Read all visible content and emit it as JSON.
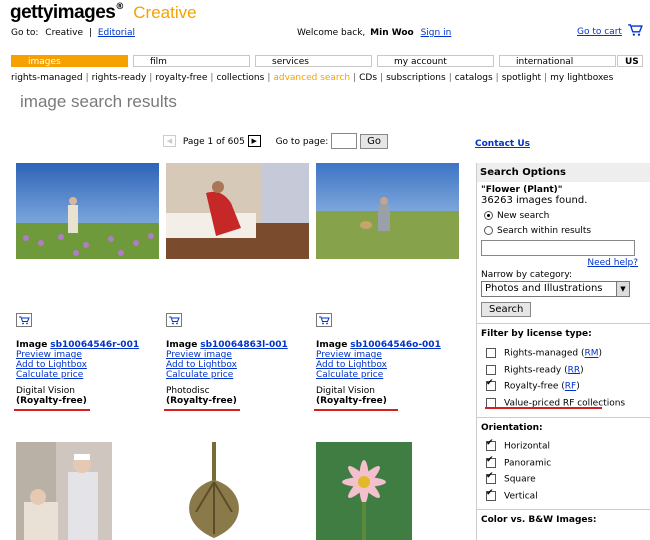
{
  "header": {
    "brand": "gettyimages",
    "brand_reg": "®",
    "brand_sub": "Creative",
    "goto_label": "Go to:",
    "goto_current": "Creative",
    "goto_sep": "|",
    "goto_link": "Editorial",
    "welcome": "Welcome back,",
    "user": "Min Woo",
    "signin": "Sign in",
    "cart": "Go to cart"
  },
  "nav": {
    "tabs": [
      {
        "label": "images",
        "active": true
      },
      {
        "label": "film"
      },
      {
        "label": "services"
      },
      {
        "label": "my account"
      },
      {
        "label": "international"
      }
    ],
    "region": "US",
    "subnav": [
      "rights-managed",
      "rights-ready",
      "royalty-free",
      "collections",
      "advanced search",
      "CDs",
      "subscriptions",
      "catalogs",
      "spotlight",
      "my lightboxes"
    ]
  },
  "page": {
    "title": "image search results",
    "pager": {
      "label": "Page 1 of 605",
      "goto": "Go to page:",
      "go": "Go"
    },
    "contact": "Contact Us"
  },
  "results": [
    {
      "label": "Image",
      "id": "sb10064546r-001",
      "preview": "Preview image",
      "lightbox": "Add to Lightbox",
      "price": "Calculate price",
      "collection": "Digital Vision",
      "license": "(Royalty-free)"
    },
    {
      "label": "Image",
      "id": "sb10064863l-001",
      "preview": "Preview image",
      "lightbox": "Add to Lightbox",
      "price": "Calculate price",
      "collection": "Photodisc",
      "license": "(Royalty-free)"
    },
    {
      "label": "Image",
      "id": "sb10064546o-001",
      "preview": "Preview image",
      "lightbox": "Add to Lightbox",
      "price": "Calculate price",
      "collection": "Digital Vision",
      "license": "(Royalty-free)"
    }
  ],
  "sidebar": {
    "title": "Search Options",
    "query": "\"Flower (Plant)\"",
    "count": "36263 images found.",
    "new_search": "New search",
    "within": "Search within results",
    "need_help": "Need help?",
    "narrow_label": "Narrow by category:",
    "category": "Photos and Illustrations",
    "search_btn": "Search",
    "filter_title": "Filter by license type:",
    "licenses": [
      {
        "label": "Rights-managed (",
        "code": "RM",
        "end": ")",
        "checked": false
      },
      {
        "label": "Rights-ready (",
        "code": "RR",
        "end": ")",
        "checked": false
      },
      {
        "label": "Royalty-free (",
        "code": "RF",
        "end": ")",
        "checked": true
      },
      {
        "label": "Value-priced RF collections",
        "code": "",
        "end": "",
        "checked": false
      }
    ],
    "orientation_title": "Orientation:",
    "orientations": [
      {
        "label": "Horizontal",
        "checked": true
      },
      {
        "label": "Panoramic",
        "checked": true
      },
      {
        "label": "Square",
        "checked": true
      },
      {
        "label": "Vertical",
        "checked": true
      }
    ],
    "color_title": "Color vs. B&W Images:"
  },
  "colors": {
    "accent": "#f7a100",
    "link": "#0033cc",
    "highlight": "#d62020"
  }
}
